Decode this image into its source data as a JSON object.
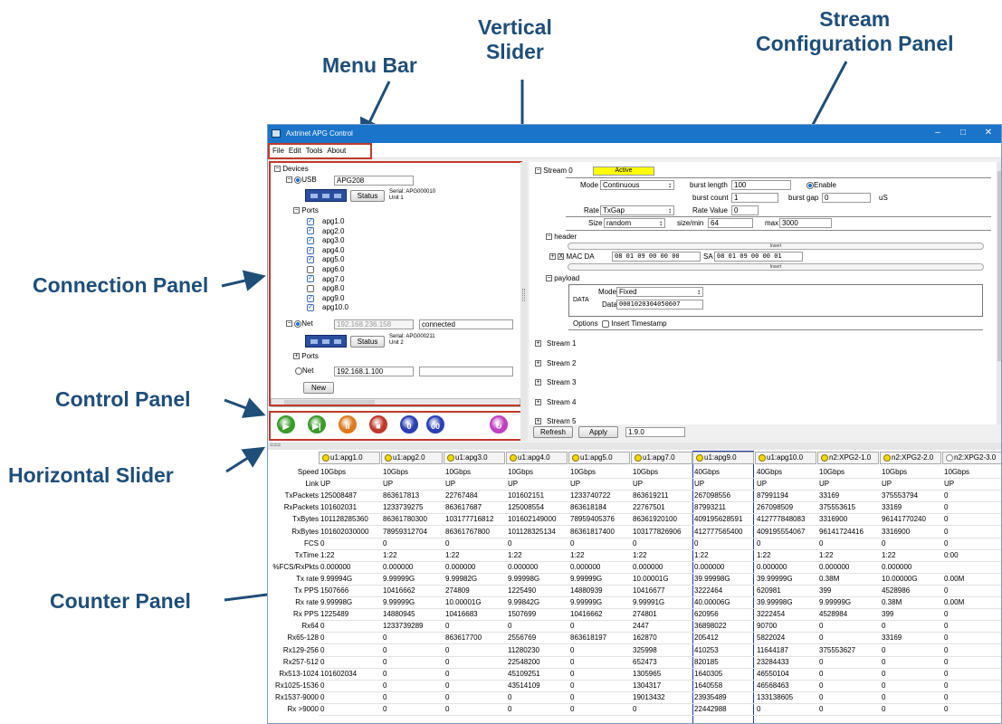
{
  "callouts": {
    "menu_bar": "Menu Bar",
    "vertical_slider": "Vertical\nSlider",
    "stream_config": "Stream\nConfiguration Panel",
    "connection_panel": "Connection Panel",
    "control_panel": "Control Panel",
    "horizontal_slider": "Horizontal Slider",
    "counter_panel": "Counter Panel"
  },
  "window": {
    "title": "Axtrinet APG Control",
    "controls": [
      "–",
      "□",
      "✕"
    ]
  },
  "menu": [
    "File",
    "Edit",
    "Tools",
    "About"
  ],
  "connection": {
    "devices_label": "Devices",
    "usb": {
      "label": "USB",
      "name": "APG208",
      "status_btn": "Status",
      "serial": "Serial: APG000010",
      "unit": "Unit 1",
      "ports_label": "Ports"
    },
    "ports": [
      {
        "name": "apg1.0",
        "checked": true
      },
      {
        "name": "apg2.0",
        "checked": true
      },
      {
        "name": "apg3.0",
        "checked": true
      },
      {
        "name": "apg4.0",
        "checked": true
      },
      {
        "name": "apg5.0",
        "checked": true
      },
      {
        "name": "apg6.0",
        "checked": false
      },
      {
        "name": "apg7.0",
        "checked": true
      },
      {
        "name": "apg8.0",
        "checked": false
      },
      {
        "name": "apg9.0",
        "checked": true
      },
      {
        "name": "apg10.0",
        "checked": true
      }
    ],
    "net": {
      "label": "Net",
      "ip": "192.168.236.158",
      "state": "connected",
      "status_btn": "Status",
      "serial": "Serial: APG000211",
      "unit": "Unit 2",
      "ports_label": "Ports"
    },
    "net2": {
      "label": "Net",
      "ip": "192.168.1.100",
      "state": ""
    },
    "new_btn": "New"
  },
  "control_buttons": [
    {
      "name": "start-button",
      "glyph": "▶",
      "color": "#3a9a2a"
    },
    {
      "name": "step-button",
      "glyph": "▶|",
      "color": "#3a9a2a"
    },
    {
      "name": "pause-button",
      "glyph": "II",
      "color": "#e07a20"
    },
    {
      "name": "stop-button",
      "glyph": "■",
      "color": "#c0392b"
    },
    {
      "name": "clear-button",
      "glyph": "0",
      "color": "#2a3fb5"
    },
    {
      "name": "clear-all-button",
      "glyph": "00",
      "color": "#2a3fb5"
    },
    {
      "name": "reset-button",
      "glyph": "↻",
      "color": "#c040c0"
    }
  ],
  "stream": {
    "name": "Stream 0",
    "state": "Active",
    "mode_label": "Mode",
    "mode": "Continuous",
    "burst_length_label": "burst length",
    "burst_length": "100",
    "enable_label": "Enable",
    "burst_count_label": "burst count",
    "burst_count": "1",
    "burst_gap_label": "burst gap",
    "burst_gap": "0",
    "burst_gap_unit": "uS",
    "rate_label": "Rate",
    "rate": "TxGap",
    "rate_value_label": "Rate Value",
    "rate_value": "0",
    "size_label": "Size",
    "size": "random",
    "size_min_label": "size/min",
    "size_min": "64",
    "max_label": "max",
    "max": "3000",
    "header_label": "header",
    "insert_label": "Insert",
    "mac_label": "MAC",
    "da_label": "DA",
    "da": "08 01 09 00 00 00",
    "sa_label": "SA",
    "sa": "08 01 09 00 00 01",
    "x_label": "X",
    "payload_label": "payload",
    "data_label": "DATA",
    "payload_mode_label": "Mode",
    "payload_mode": "Fixed",
    "payload_data_label": "Data",
    "payload_data": "0001020304050607",
    "options_label": "Options",
    "timestamp_label": "Insert Timestamp",
    "others": [
      "Stream 1",
      "Stream 2",
      "Stream 3",
      "Stream 4",
      "Stream 5"
    ],
    "refresh_btn": "Refresh",
    "apply_btn": "Apply",
    "version": "1.9.0"
  },
  "slider_grip": "===",
  "counters": {
    "columns": [
      {
        "name": "u1:apg1.0",
        "on": true
      },
      {
        "name": "u1:apg2.0",
        "on": true
      },
      {
        "name": "u1:apg3.0",
        "on": true
      },
      {
        "name": "u1:apg4.0",
        "on": true
      },
      {
        "name": "u1:apg5.0",
        "on": true
      },
      {
        "name": "u1:apg7.0",
        "on": true
      },
      {
        "name": "u1:apg9.0",
        "on": true
      },
      {
        "name": "u1:apg10.0",
        "on": true
      },
      {
        "name": "n2:XPG2-1.0",
        "on": true
      },
      {
        "name": "n2:XPG2-2.0",
        "on": true
      },
      {
        "name": "n2:XPG2-3.0",
        "on": false
      }
    ],
    "rows": [
      {
        "label": "Speed",
        "values": [
          "10Gbps",
          "10Gbps",
          "10Gbps",
          "10Gbps",
          "10Gbps",
          "10Gbps",
          "40Gbps",
          "40Gbps",
          "10Gbps",
          "10Gbps",
          "10Gbps"
        ]
      },
      {
        "label": "Link",
        "values": [
          "UP",
          "UP",
          "UP",
          "UP",
          "UP",
          "UP",
          "UP",
          "UP",
          "UP",
          "UP",
          "UP"
        ]
      },
      {
        "label": "TxPackets",
        "values": [
          "125008487",
          "863617813",
          "22767484",
          "101602151",
          "1233740722",
          "863619211",
          "267098556",
          "87991194",
          "33169",
          "375553794",
          "0"
        ]
      },
      {
        "label": "RxPackets",
        "values": [
          "101602031",
          "1233739275",
          "863617687",
          "125008554",
          "863618184",
          "22767501",
          "87993211",
          "267098509",
          "375553615",
          "33169",
          "0"
        ]
      },
      {
        "label": "TxBytes",
        "values": [
          "101128285360",
          "86361780300",
          "103177716812",
          "101602149000",
          "78959405376",
          "86361920100",
          "409195628591",
          "412777848083",
          "3316900",
          "96141770240",
          "0"
        ]
      },
      {
        "label": "RxBytes",
        "values": [
          "101602030000",
          "78959312704",
          "86361767800",
          "101128325134",
          "86361817400",
          "103177826906",
          "412777565400",
          "409195554067",
          "96141724416",
          "3316900",
          "0"
        ]
      },
      {
        "label": "FCS",
        "values": [
          "0",
          "0",
          "0",
          "0",
          "0",
          "0",
          "0",
          "0",
          "0",
          "0",
          "0"
        ]
      },
      {
        "label": "TxTime",
        "values": [
          "1:22",
          "1:22",
          "1:22",
          "1:22",
          "1:22",
          "1:22",
          "1:22",
          "1:22",
          "1:22",
          "1:22",
          "0:00"
        ]
      },
      {
        "label": "%FCS/RxPkts",
        "values": [
          "0.000000",
          "0.000000",
          "0.000000",
          "0.000000",
          "0.000000",
          "0.000000",
          "0.000000",
          "0.000000",
          "0.000000",
          "0.000000",
          ""
        ]
      },
      {
        "label": "Tx rate",
        "values": [
          "9.99994G",
          "9.99999G",
          "9.99982G",
          "9.99998G",
          "9.99999G",
          "10.00001G",
          "39.99998G",
          "39.99999G",
          "0.38M",
          "10.00000G",
          "0.00M"
        ]
      },
      {
        "label": "Tx PPS",
        "values": [
          "1507666",
          "10416662",
          "274809",
          "1225490",
          "14880939",
          "10416677",
          "3222464",
          "620981",
          "399",
          "4528986",
          "0"
        ]
      },
      {
        "label": "Rx rate",
        "values": [
          "9.99998G",
          "9.99999G",
          "10.00001G",
          "9.99842G",
          "9.99999G",
          "9.99991G",
          "40.00006G",
          "39.99998G",
          "9.99999G",
          "0.38M",
          "0.00M"
        ]
      },
      {
        "label": "Rx PPS",
        "values": [
          "1225489",
          "14880945",
          "10416683",
          "1507699",
          "10416662",
          "274801",
          "620956",
          "3222454",
          "4528984",
          "399",
          "0"
        ]
      },
      {
        "label": "Rx64",
        "values": [
          "0",
          "1233739289",
          "0",
          "0",
          "0",
          "2447",
          "36898022",
          "90700",
          "0",
          "0",
          "0"
        ]
      },
      {
        "label": "Rx65-128",
        "values": [
          "0",
          "0",
          "863617700",
          "2556769",
          "863618197",
          "162870",
          "205412",
          "5822024",
          "0",
          "33169",
          "0"
        ]
      },
      {
        "label": "Rx129-256",
        "values": [
          "0",
          "0",
          "0",
          "11280230",
          "0",
          "325998",
          "410253",
          "11644187",
          "375553627",
          "0",
          "0"
        ]
      },
      {
        "label": "Rx257-512",
        "values": [
          "0",
          "0",
          "0",
          "22548200",
          "0",
          "652473",
          "820185",
          "23284433",
          "0",
          "0",
          "0"
        ]
      },
      {
        "label": "Rx513-1024",
        "values": [
          "101602034",
          "0",
          "0",
          "45109251",
          "0",
          "1305965",
          "1640305",
          "46550104",
          "0",
          "0",
          "0"
        ]
      },
      {
        "label": "Rx1025-1536",
        "values": [
          "0",
          "0",
          "0",
          "43514109",
          "0",
          "1304317",
          "1640558",
          "46568463",
          "0",
          "0",
          "0"
        ]
      },
      {
        "label": "Rx1537-9000",
        "values": [
          "0",
          "0",
          "0",
          "0",
          "0",
          "19013432",
          "23935489",
          "133138605",
          "0",
          "0",
          "0"
        ]
      },
      {
        "label": "Rx >9000",
        "values": [
          "0",
          "0",
          "0",
          "0",
          "0",
          "0",
          "22442988",
          "0",
          "0",
          "0",
          "0"
        ]
      }
    ]
  }
}
